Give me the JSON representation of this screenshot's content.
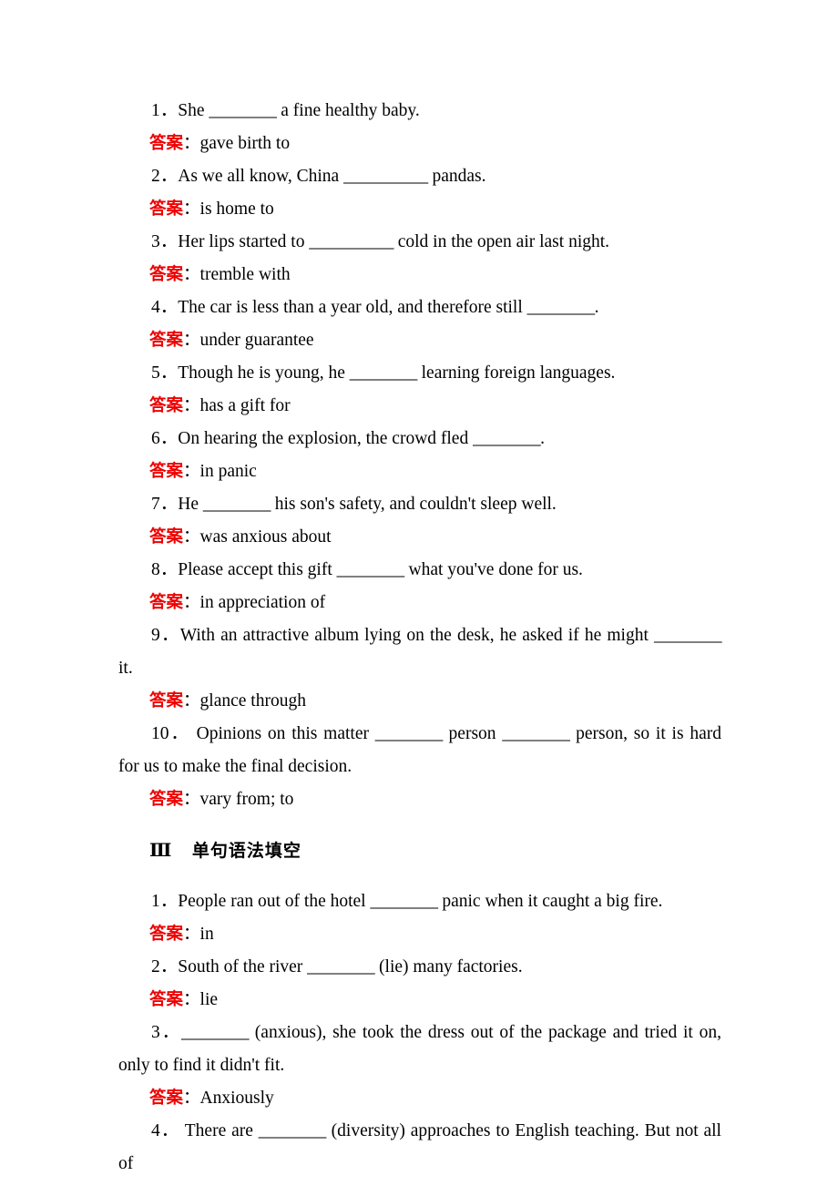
{
  "page": {
    "answer_label": "答案",
    "answer_colon": "：",
    "blank_short": "________",
    "blank_long": "__________"
  },
  "exercises_part2": [
    {
      "number": "1．",
      "text_before": "She ",
      "blank": "________",
      "text_after": " a fine healthy baby.",
      "answer": "gave birth to"
    },
    {
      "number": "2．",
      "text_before": "As we all know, China ",
      "blank": "__________",
      "text_after": "  pandas.",
      "answer": "is home to"
    },
    {
      "number": "3．",
      "text_before": "Her lips started to ",
      "blank": "__________",
      "text_after": "  cold in the open air last night.",
      "answer": "tremble with"
    },
    {
      "number": "4．",
      "text_before": "The car is less than a year old, and therefore still ",
      "blank": "________",
      "text_after": ".",
      "answer": "under guarantee"
    },
    {
      "number": "5．",
      "text_before": "Though he is young, he ",
      "blank": "________",
      "text_after": " learning foreign languages.",
      "answer": "has a gift for"
    },
    {
      "number": "6．",
      "text_before": "On hearing the explosion, the crowd   fled ",
      "blank": "________",
      "text_after": ".",
      "answer": "in panic"
    },
    {
      "number": "7．",
      "text_before": "He ",
      "blank": "________",
      "text_after": " his son's safety, and couldn't sleep well.",
      "answer": "was anxious about"
    },
    {
      "number": "8．",
      "text_before": "Please accept this gift ",
      "blank": "________",
      "text_after": " what you've done for us.",
      "answer": "in appreciation of"
    },
    {
      "number": "9．",
      "text_before": "With an attractive album lying on the desk, he asked if he might ",
      "blank": "________",
      "text_after": " it.",
      "answer": "glance through"
    },
    {
      "number": "10．",
      "text_before": " Opinions on this matter ",
      "blank": "________",
      "text_mid": " person ",
      "blank2": "________",
      "text_after": " person, so it is hard for us to make the final decision.",
      "answer": "vary from; to"
    }
  ],
  "section_three": {
    "numeral": "Ⅲ",
    "title": "单句语法填空"
  },
  "exercises_part3": [
    {
      "number": "1．",
      "text_before": "People ran out of the hotel ",
      "blank": "________",
      "text_after": " panic when it caught a big fire.",
      "answer": "in"
    },
    {
      "number": "2．",
      "text_before": "South of the river ",
      "blank": "________",
      "text_after": " (lie) many factories.",
      "answer": "lie"
    },
    {
      "number": "3．",
      "text_before": "",
      "blank": "________",
      "text_after": " (anxious), she took the dress out of the package and tried it on, only to find it didn't fit.",
      "answer": "Anxiously"
    },
    {
      "number": "4．",
      "text_before": " There are ",
      "blank": "________",
      "text_after": " (diversity) approaches to English teaching. But not all of",
      "answer": null
    }
  ],
  "colors": {
    "answer_red": "#EE0000",
    "body_text": "#000000",
    "page_background": "#FFFFFF"
  }
}
